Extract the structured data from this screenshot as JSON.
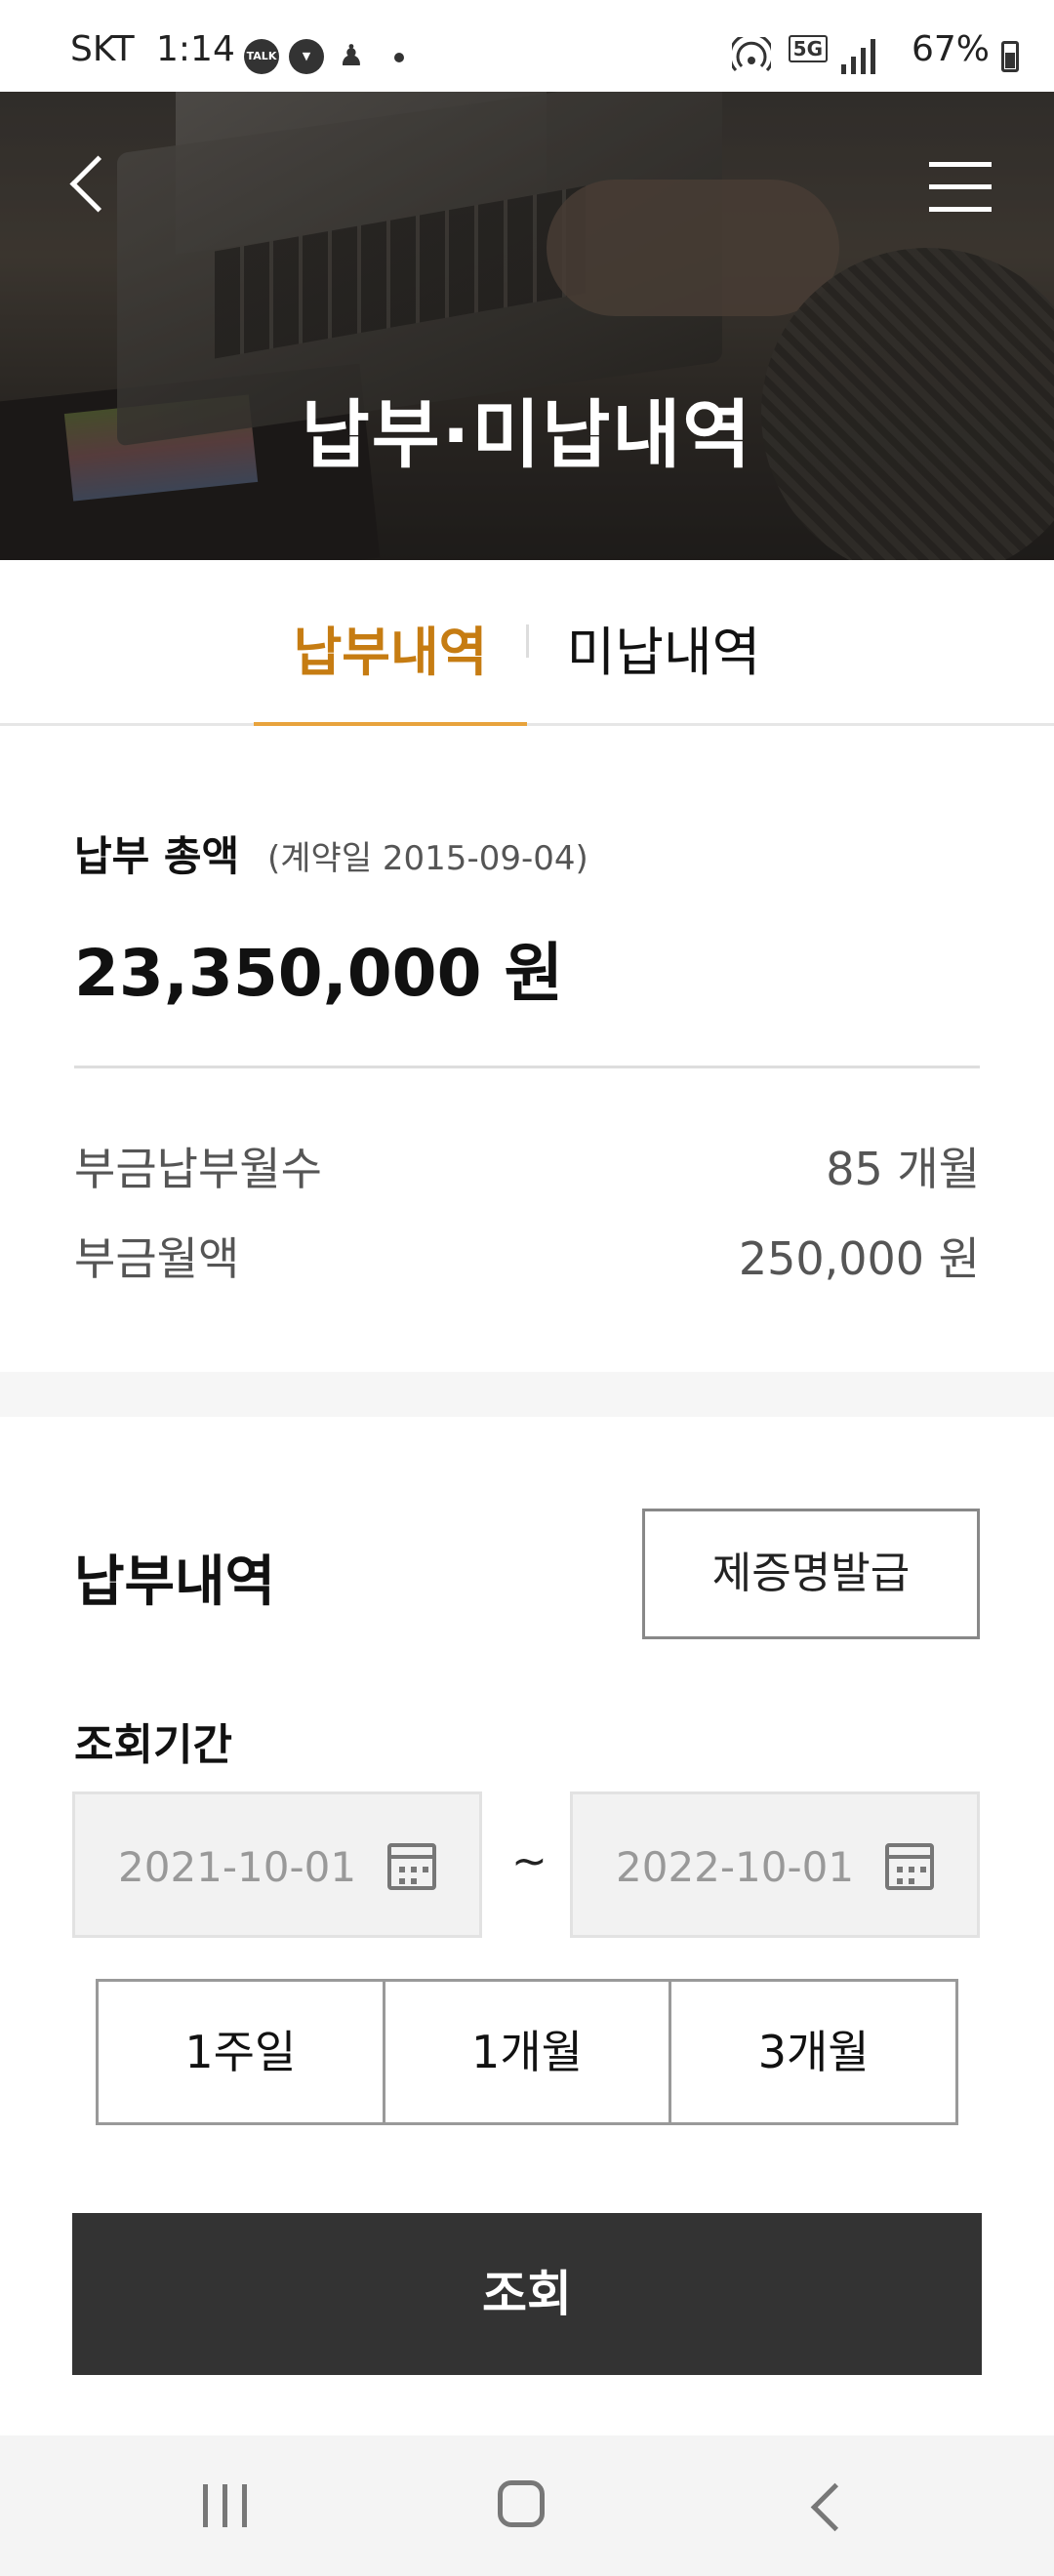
{
  "status_bar": {
    "carrier": "SKT",
    "time": "1:14",
    "notification_icons": [
      "talk-icon",
      "shield-icon",
      "person-icon"
    ],
    "network": "5G",
    "battery": "67%"
  },
  "header": {
    "title": "납부·미납내역",
    "back_icon": "chevron-left-icon",
    "menu_icon": "hamburger-menu-icon"
  },
  "tabs": [
    {
      "label": "납부내역",
      "active": true
    },
    {
      "label": "미납내역",
      "active": false
    }
  ],
  "summary": {
    "label": "납부 총액",
    "contract_note": "(계약일 2015-09-04)",
    "total_amount": "23,350,000 원",
    "rows": [
      {
        "label": "부금납부월수",
        "value": "85 개월"
      },
      {
        "label": "부금월액",
        "value": "250,000 원"
      }
    ]
  },
  "history": {
    "title": "납부내역",
    "certificate_button": "제증명발급",
    "period_label": "조회기간",
    "from_date": "2021-10-01",
    "to_date": "2022-10-01",
    "separator": "~",
    "range_buttons": [
      "1주일",
      "1개월",
      "3개월"
    ],
    "search_button": "조회"
  },
  "colors": {
    "accent": "#c67c12",
    "accent_bar": "#e8a33c",
    "button_dark": "#333333"
  }
}
